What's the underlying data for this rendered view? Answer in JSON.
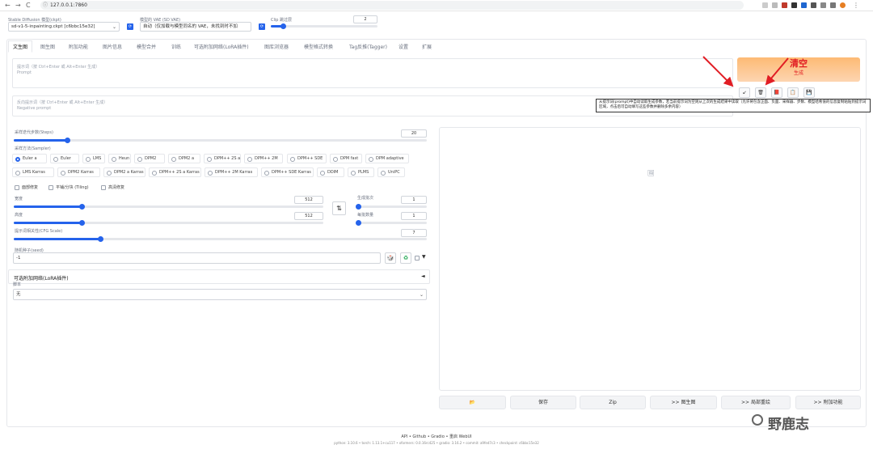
{
  "browser": {
    "url": "127.0.0.1:7860",
    "nav": {
      "back": "←",
      "forward": "→",
      "reload": "C"
    },
    "menu": "⋮"
  },
  "top": {
    "model_label": "Stable Diffusion 模型(ckpt)",
    "model_value": "sd-v1-5-inpainting.ckpt [c6bbc15e32]",
    "vae_label": "模型的 VAE (SD VAE)",
    "vae_value": "自动（仅加载与模型同名的 VAE，未找到时不加",
    "clip_label": "Clip 跳过层",
    "clip_value": "2"
  },
  "tabs": [
    "文生图",
    "图生图",
    "附加功能",
    "图片信息",
    "模型合并",
    "训练",
    "可选附加网络(LoRA插件)",
    "图库浏览器",
    "模型格式转换",
    "Tag反推(Tagger)",
    "设置",
    "扩展"
  ],
  "prompt": {
    "placeholder_line1": "提示词（按 Ctrl+Enter 或 Alt+Enter 生成）",
    "placeholder_line2": "Prompt",
    "neg_line1": "反向提示词（按 Ctrl+Enter 或 Alt+Enter 生成）",
    "neg_line2": "Negative prompt"
  },
  "generate": {
    "label": "生成",
    "annotation": "清空",
    "tool_icons": [
      "↙",
      "🗑",
      "📕",
      "📋",
      "💾"
    ],
    "tooltip": "从提示词(prompt)中自动读取生成参数，若当前提示词为空则从上次的生成结果中读取（允许将包含正面、负面、采样器、步数、模型哈希值的信息复制粘贴到提示词区域，点击后可自动填写这些参数并删除多余内容）"
  },
  "params": {
    "steps_label": "采样迭代步数(Steps)",
    "steps_value": "20",
    "steps_fraction": 0.13,
    "sampler_label": "采样方法(Sampler)",
    "samplers_row1": [
      "Euler a",
      "Euler",
      "LMS",
      "Heun",
      "DPM2",
      "DPM2 a",
      "DPM++ 2S a",
      "DPM++ 2M",
      "DPM++ SDE",
      "DPM fast",
      "DPM adaptive"
    ],
    "samplers_row2": [
      "LMS Karras",
      "DPM2 Karras",
      "DPM2 a Karras",
      "DPM++ 2S a Karras",
      "DPM++ 2M Karras",
      "DPM++ SDE Karras",
      "DDIM",
      "PLMS",
      "UniPC"
    ],
    "selected_sampler": "Euler a",
    "checks": [
      "面部修复",
      "平铺/分块 (Tiling)",
      "高清修复"
    ],
    "width_label": "宽度",
    "width_value": "512",
    "width_fraction": 0.22,
    "height_label": "高度",
    "height_value": "512",
    "height_fraction": 0.22,
    "swap_icon": "⇅",
    "batch_count_label": "生成批次",
    "batch_count_value": "1",
    "batch_size_label": "每批数量",
    "batch_size_value": "1",
    "cfg_label": "提示词相关性(CFG Scale)",
    "cfg_value": "7",
    "cfg_fraction": 0.21,
    "seed_label": "随机种子(seed)",
    "seed_value": "-1",
    "seed_btn_dice": "🎲",
    "seed_btn_recycle": "♻",
    "extra_toggle": "▼",
    "lora_title": "可选附加网络(LoRA插件)",
    "lora_toggle": "◄",
    "script_label": "脚本",
    "script_value": "无"
  },
  "output": {
    "image_placeholder_icon": "🖼",
    "buttons": [
      "📂",
      "保存",
      "Zip",
      ">> 图生图",
      ">> 局部重绘",
      ">> 附加功能"
    ]
  },
  "footer": {
    "links": "API  •  Github  •  Gradio  •  重启 WebUI",
    "versions": "python: 3.10.6  •  torch: 1.13.1+cu117  •  xformers: 0.0.16rc425  •  gradio: 3.16.2  •  commit: a9fed7c3  •  checkpoint: c6bbc15e32"
  },
  "watermark": "野鹿志",
  "colors": {
    "accent": "#2563eb",
    "generate_start": "#fdba74",
    "generate_end": "#fdd5b1",
    "annotation": "#e11d24"
  }
}
